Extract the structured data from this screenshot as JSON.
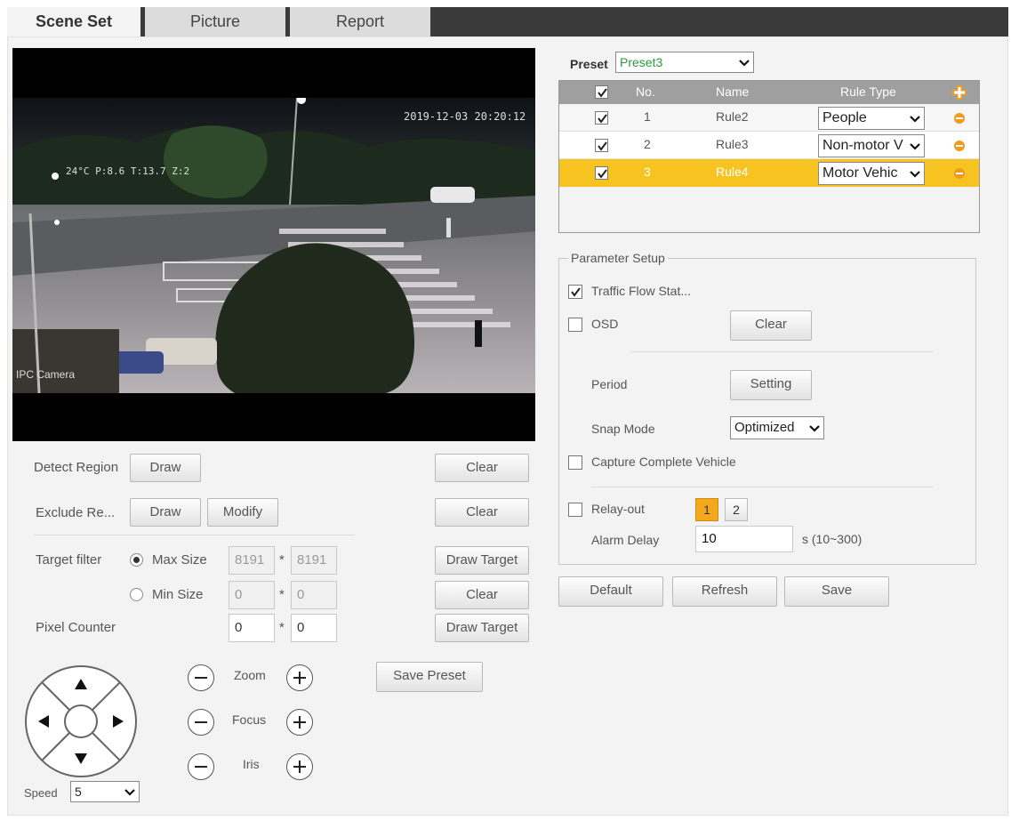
{
  "tabs": [
    {
      "label": "Scene Set"
    },
    {
      "label": "Picture"
    },
    {
      "label": "Report"
    }
  ],
  "video": {
    "timestamp": "2019-12-03 20:20:12",
    "overlay": "24°C P:8.6 T:13.7 Z:2",
    "camera_name": "IPC Camera"
  },
  "left": {
    "detect_region_label": "Detect Region",
    "exclude_region_label": "Exclude Re...",
    "draw_label": "Draw",
    "modify_label": "Modify",
    "clear_label": "Clear",
    "target_filter_label": "Target filter",
    "max_size_label": "Max Size",
    "max_w": "8191",
    "max_h": "8191",
    "min_size_label": "Min Size",
    "min_w": "0",
    "min_h": "0",
    "draw_target_label": "Draw Target",
    "pixel_counter_label": "Pixel Counter",
    "pix_w": "0",
    "pix_h": "0",
    "times": "*",
    "zoom_label": "Zoom",
    "focus_label": "Focus",
    "iris_label": "Iris",
    "save_preset_label": "Save Preset",
    "speed_label": "Speed",
    "speed_value": "5"
  },
  "preset": {
    "label": "Preset",
    "value": "Preset3"
  },
  "rules": {
    "headers": {
      "no": "No.",
      "name": "Name",
      "type": "Rule Type"
    },
    "rows": [
      {
        "no": "1",
        "name": "Rule2",
        "type": "People"
      },
      {
        "no": "2",
        "name": "Rule3",
        "type": "Non-motor V"
      },
      {
        "no": "3",
        "name": "Rule4",
        "type": "Motor Vehic"
      }
    ]
  },
  "params": {
    "legend": "Parameter Setup",
    "traffic_flow": "Traffic Flow Stat...",
    "osd": "OSD",
    "clear_label": "Clear",
    "period_label": "Period",
    "setting_label": "Setting",
    "snap_mode_label": "Snap Mode",
    "snap_mode_value": "Optimized",
    "capture_label": "Capture Complete Vehicle",
    "relay_label": "Relay-out",
    "relay_1": "1",
    "relay_2": "2",
    "alarm_delay_label": "Alarm Delay",
    "alarm_delay_value": "10",
    "alarm_delay_range": "s (10~300)"
  },
  "footer": {
    "default_label": "Default",
    "refresh_label": "Refresh",
    "save_label": "Save"
  },
  "colors": {
    "selected_row": "#f6c320",
    "relay_active": "#f4a81e",
    "remove_icon": "#f29a1e",
    "preset_text": "#2b9a3a"
  }
}
